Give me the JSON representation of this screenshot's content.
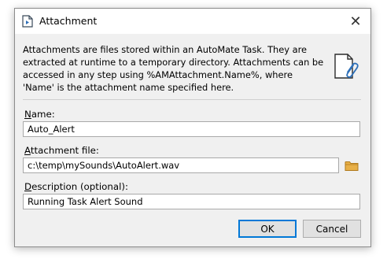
{
  "window": {
    "title": "Attachment",
    "close_glyph": "✕"
  },
  "description": "Attachments are files stored within an AutoMate Task. They are extracted at runtime to a temporary directory. Attachments can be accessed in any step using %AMAttachment.Name%, where 'Name' is the attachment name specified here.",
  "fields": {
    "name": {
      "label_mnemonic": "N",
      "label_rest": "ame:",
      "value": "Auto_Alert"
    },
    "attachment_file": {
      "label_mnemonic": "A",
      "label_rest": "ttachment file:",
      "value": "c:\\temp\\mySounds\\AutoAlert.wav"
    },
    "description": {
      "label_mnemonic": "D",
      "label_rest": "escription (optional):",
      "value": "Running Task Alert Sound"
    }
  },
  "buttons": {
    "ok": "OK",
    "cancel": "Cancel"
  },
  "icons": {
    "title": "attachment-doc-icon",
    "main": "paperclip-document-icon",
    "browse": "folder-icon"
  },
  "colors": {
    "accent": "#0078d7",
    "folder": "#e8b048"
  }
}
